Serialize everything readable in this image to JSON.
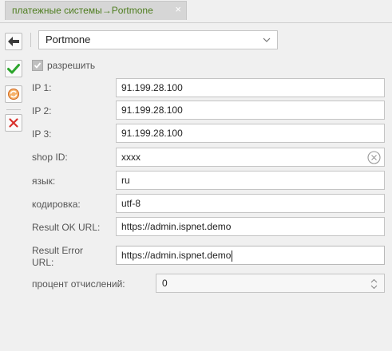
{
  "tab": {
    "title": "платежные системы→Portmone",
    "close_glyph": "×"
  },
  "toolbar": {
    "back_icon": "arrow-left-icon",
    "save_icon": "checkmark-icon",
    "apply_icon": "refresh-icon",
    "cancel_icon": "cross-icon"
  },
  "system_select": {
    "value": "Portmone"
  },
  "allow": {
    "label": "разрешить",
    "checked": true
  },
  "form": {
    "ip1": {
      "label": "IP 1:",
      "value": "91.199.28.100"
    },
    "ip2": {
      "label": "IP 2:",
      "value": "91.199.28.100"
    },
    "ip3": {
      "label": "IP 3:",
      "value": "91.199.28.100"
    },
    "shop_id": {
      "label": "shop ID:",
      "value": "xxxx"
    },
    "language": {
      "label": "язык:",
      "value": "ru"
    },
    "encoding": {
      "label": "кодировка:",
      "value": "utf-8"
    },
    "result_ok_url": {
      "label": "Result OK URL:",
      "value": "https://admin.ispnet.demo"
    },
    "result_error_url": {
      "label_line1": "Result Error",
      "label_line2": "URL:",
      "value": "https://admin.ispnet.demo"
    },
    "percent": {
      "label": "процент отчислений:",
      "value": "0"
    }
  },
  "colors": {
    "tab_text": "#4e7d1f",
    "save_green": "#2da52d",
    "cancel_red": "#d9302b",
    "apply_orange": "#e0782a"
  }
}
